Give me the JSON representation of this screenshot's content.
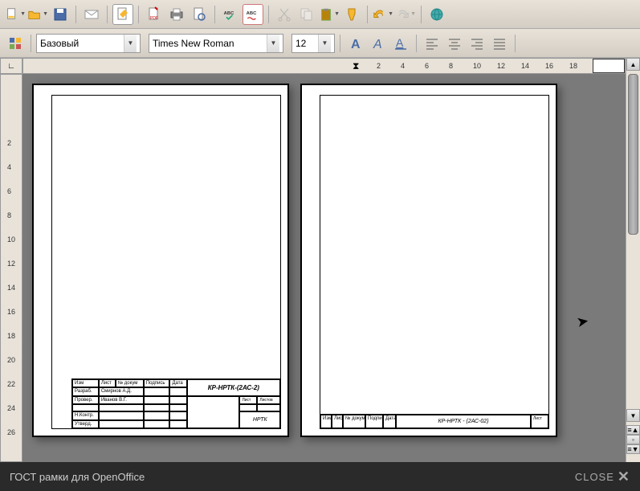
{
  "toolbar1": {
    "icons": [
      "new-doc",
      "open",
      "save",
      "mail",
      "edit",
      "pdf",
      "print",
      "print-preview",
      "spellcheck-abc",
      "spellcheck-auto",
      "cut",
      "copy",
      "paste",
      "format-paint",
      "undo",
      "redo",
      "",
      "hyperlink"
    ]
  },
  "toolbar2": {
    "style_label": "Базовый",
    "font_label": "Times New Roman",
    "size_label": "12"
  },
  "ruler_h": [
    "2",
    "4",
    "6",
    "8",
    "10",
    "12",
    "14",
    "16",
    "18"
  ],
  "ruler_v": [
    "2",
    "4",
    "6",
    "8",
    "10",
    "12",
    "14",
    "16",
    "18",
    "20",
    "22",
    "24",
    "26"
  ],
  "page1": {
    "doc_code": "КР-НРТК-(2АС-2)",
    "org": "НРТК",
    "rows": [
      {
        "role": "Изм",
        "name": "Лист",
        "col3": "№ докум",
        "col4": "Подпись",
        "col5": "Дата"
      },
      {
        "role": "Разраб.",
        "name": "Смирнов А.Д."
      },
      {
        "role": "Провер.",
        "name": "Иванов В.Г."
      },
      {
        "role": "Н.Контр.",
        "name": ""
      },
      {
        "role": "Утверд.",
        "name": ""
      }
    ],
    "sheet_label": "Лист",
    "sheets_label": "Листов"
  },
  "page2": {
    "doc_code": "КР-НРТК - (2АС-02)",
    "row": {
      "c1": "Изм",
      "c2": "Лист",
      "c3": "№ докум.",
      "c4": "Подпись",
      "c5": "Дата"
    },
    "sheet_label": "Лист"
  },
  "footer": {
    "caption": "ГОСТ рамки для OpenOffice",
    "close": "CLOSE"
  }
}
